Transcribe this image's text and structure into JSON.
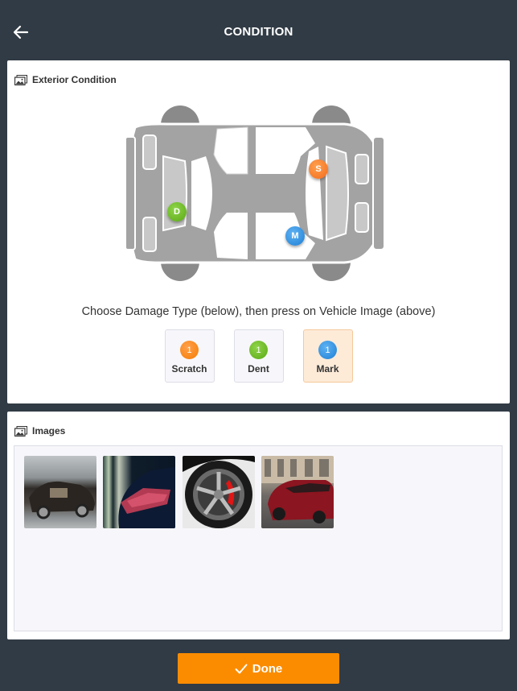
{
  "header": {
    "title": "CONDITION",
    "back_icon": "arrow-left-icon"
  },
  "exterior": {
    "heading": "Exterior Condition",
    "heading_icon": "images-icon",
    "markers": [
      {
        "letter": "S",
        "type": "Scratch",
        "color": "#f26b1d"
      },
      {
        "letter": "D",
        "type": "Dent",
        "color": "#5aa915"
      },
      {
        "letter": "M",
        "type": "Mark",
        "color": "#1e7fd6"
      }
    ],
    "instruction": "Choose Damage Type (below), then press on Vehicle Image (above)",
    "damage_types": [
      {
        "label": "Scratch",
        "count": "1",
        "color": "#f57c00",
        "selected": false
      },
      {
        "label": "Dent",
        "count": "1",
        "color": "#5aa915",
        "selected": false
      },
      {
        "label": "Mark",
        "count": "1",
        "color": "#1e7fd6",
        "selected": true
      }
    ]
  },
  "images": {
    "heading": "Images",
    "heading_icon": "images-icon",
    "thumbnails": [
      {
        "description": "black sedan with doors open"
      },
      {
        "description": "red tail light close-up"
      },
      {
        "description": "alloy wheel with red brake caliper"
      },
      {
        "description": "red sports car on street"
      }
    ]
  },
  "footer": {
    "done_label": "Done",
    "done_icon": "checkmark-icon",
    "accent": "#fb8c00"
  }
}
